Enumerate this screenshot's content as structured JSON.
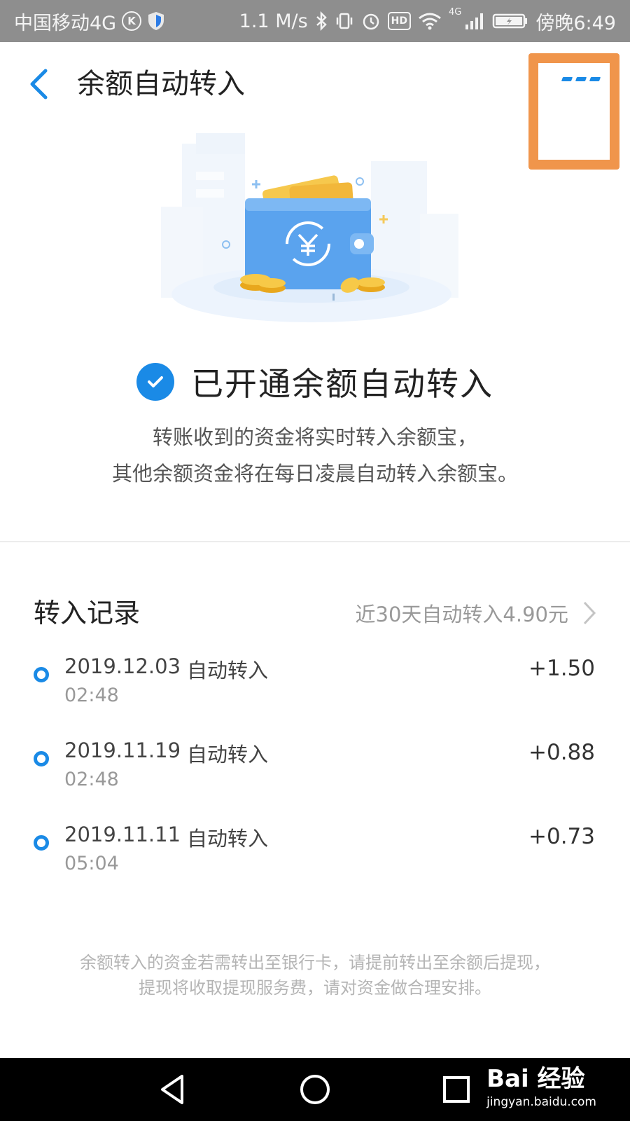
{
  "status_bar": {
    "carrier": "中国移动4G",
    "carrier_badge": "K",
    "speed": "1.1 M/s",
    "hd": "HD",
    "network": "4G",
    "time": "傍晚6:49"
  },
  "header": {
    "title": "余额自动转入"
  },
  "status": {
    "headline": "已开通余额自动转入",
    "desc_line1": "转账收到的资金将实时转入余额宝，",
    "desc_line2": "其他余额资金将在每日凌晨自动转入余额宝。"
  },
  "records": {
    "title": "转入记录",
    "summary": "近30天自动转入4.90元",
    "items": [
      {
        "date": "2019.12.03",
        "type": "自动转入",
        "time": "02:48",
        "amount": "+1.50"
      },
      {
        "date": "2019.11.19",
        "type": "自动转入",
        "time": "02:48",
        "amount": "+0.88"
      },
      {
        "date": "2019.11.11",
        "type": "自动转入",
        "time": "05:04",
        "amount": "+0.73"
      }
    ]
  },
  "footnote": {
    "line1": "余额转入的资金若需转出至银行卡，请提前转出至余额后提现，",
    "line2": "提现将收取提现服务费，请对资金做合理安排。"
  },
  "watermark": {
    "logo": "Bai 经验",
    "url": "jingyan.baidu.com"
  },
  "colors": {
    "accent": "#1a8ae6",
    "highlight": "#f0954b",
    "status_bar": "#8e8e8e"
  },
  "icons": [
    "back-arrow-icon",
    "more-icon",
    "check-icon",
    "chevron-right-icon",
    "nav-back-icon",
    "nav-home-icon",
    "nav-recents-icon"
  ]
}
